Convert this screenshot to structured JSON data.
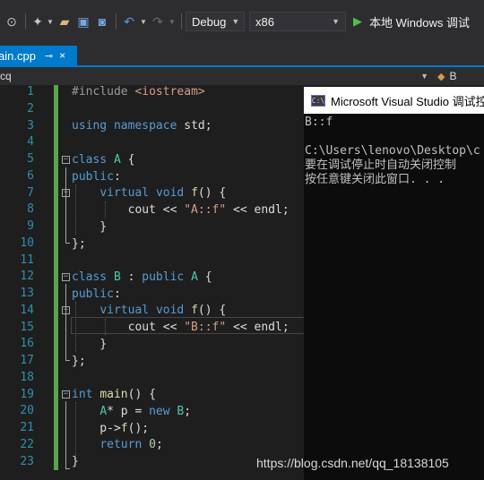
{
  "toolbar": {
    "config_value": "Debug",
    "platform_value": "x86",
    "run_label": "本地 Windows 调试"
  },
  "tab": {
    "file_name": "main.cpp",
    "visible_label": "ain.cpp",
    "pin_glyph": "⊸",
    "close_glyph": "×"
  },
  "navbar": {
    "left_value": "cq",
    "right_value": "B"
  },
  "editor": {
    "line_numbers": [
      "1",
      "2",
      "3",
      "4",
      "5",
      "6",
      "7",
      "8",
      "9",
      "10",
      "11",
      "12",
      "13",
      "14",
      "15",
      "16",
      "17",
      "18",
      "19",
      "20",
      "21",
      "22",
      "23"
    ]
  },
  "console": {
    "title": "Microsoft Visual Studio 调试控",
    "lines": [
      "B::f",
      "",
      "C:\\Users\\lenovo\\Desktop\\c",
      "要在调试停止时自动关闭控制",
      "按任意键关闭此窗口. . ."
    ]
  },
  "watermark": "https://blog.csdn.net/qq_18138105",
  "colors": {
    "accent": "#007acc",
    "keyword": "#569cd6",
    "type": "#4ec9b0",
    "function": "#dcdcaa",
    "string": "#d69d85",
    "line_number": "#2b91af",
    "changed_bar": "#57a64a"
  }
}
